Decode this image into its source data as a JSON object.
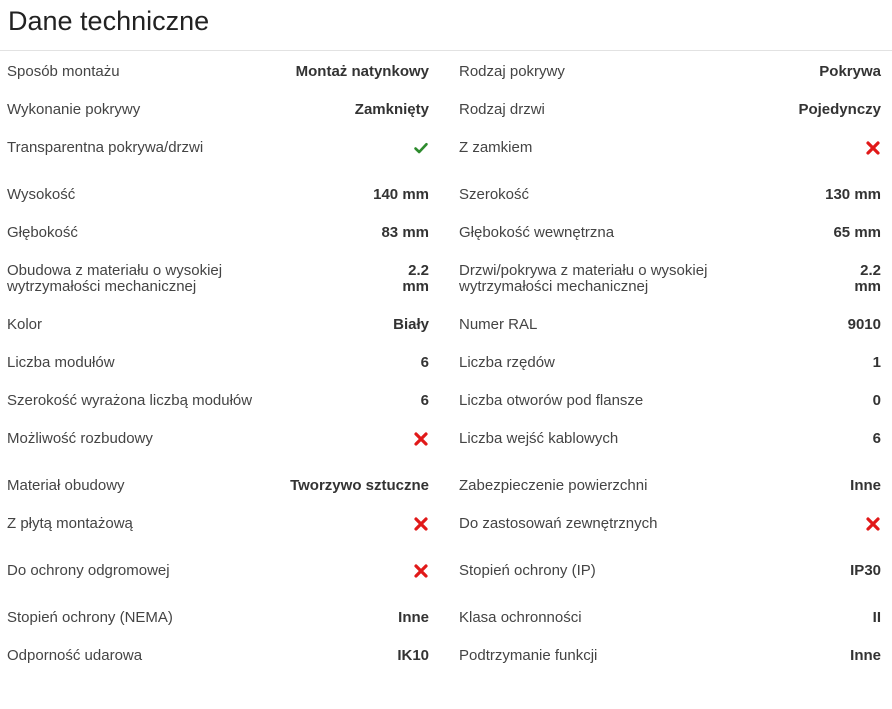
{
  "page_title": "Dane techniczne",
  "colors": {
    "check": "#2e8b2e",
    "cross": "#e11919"
  },
  "left_rows": [
    {
      "label": "Sposób montażu",
      "value": "Montaż natynkowy"
    },
    {
      "label": "Wykonanie pokrywy",
      "value": "Zamknięty"
    },
    {
      "label": "Transparentna pokrywa/drzwi",
      "icon": "check-icon"
    },
    {
      "label": "Wysokość",
      "value": "140 mm"
    },
    {
      "label": "Głębokość",
      "value": "83 mm"
    },
    {
      "label": "Obudowa z materiału o wysokiej wytrzymałości mechanicznej",
      "value": "2.2 mm"
    },
    {
      "label": "Kolor",
      "value": "Biały"
    },
    {
      "label": "Liczba modułów",
      "value": "6"
    },
    {
      "label": "Szerokość wyrażona liczbą modułów",
      "value": "6"
    },
    {
      "label": "Możliwość rozbudowy",
      "icon": "cross-icon"
    },
    {
      "label": "Materiał obudowy",
      "value": "Tworzywo sztuczne"
    },
    {
      "label": "Z płytą montażową",
      "icon": "cross-icon"
    },
    {
      "label": "Do ochrony odgromowej",
      "icon": "cross-icon"
    },
    {
      "label": "Stopień ochrony (NEMA)",
      "value": "Inne"
    },
    {
      "label": "Odporność udarowa",
      "value": "IK10"
    }
  ],
  "right_rows": [
    {
      "label": "Rodzaj pokrywy",
      "value": "Pokrywa"
    },
    {
      "label": "Rodzaj drzwi",
      "value": "Pojedynczy"
    },
    {
      "label": "Z zamkiem",
      "icon": "cross-icon"
    },
    {
      "label": "Szerokość",
      "value": "130 mm"
    },
    {
      "label": "Głębokość wewnętrzna",
      "value": "65 mm"
    },
    {
      "label": "Drzwi/pokrywa z materiału o wysokiej wytrzymałości mechanicznej",
      "value": "2.2 mm"
    },
    {
      "label": "Numer RAL",
      "value": "9010"
    },
    {
      "label": "Liczba rzędów",
      "value": "1"
    },
    {
      "label": "Liczba otworów pod flansze",
      "value": "0"
    },
    {
      "label": "Liczba wejść kablowych",
      "value": "6"
    },
    {
      "label": "Zabezpieczenie powierzchni",
      "value": "Inne"
    },
    {
      "label": "Do zastosowań zewnętrznych",
      "icon": "cross-icon"
    },
    {
      "label": "Stopień ochrony (IP)",
      "value": "IP30"
    },
    {
      "label": "Klasa ochronności",
      "value": "II"
    },
    {
      "label": "Podtrzymanie funkcji",
      "value": "Inne"
    }
  ]
}
